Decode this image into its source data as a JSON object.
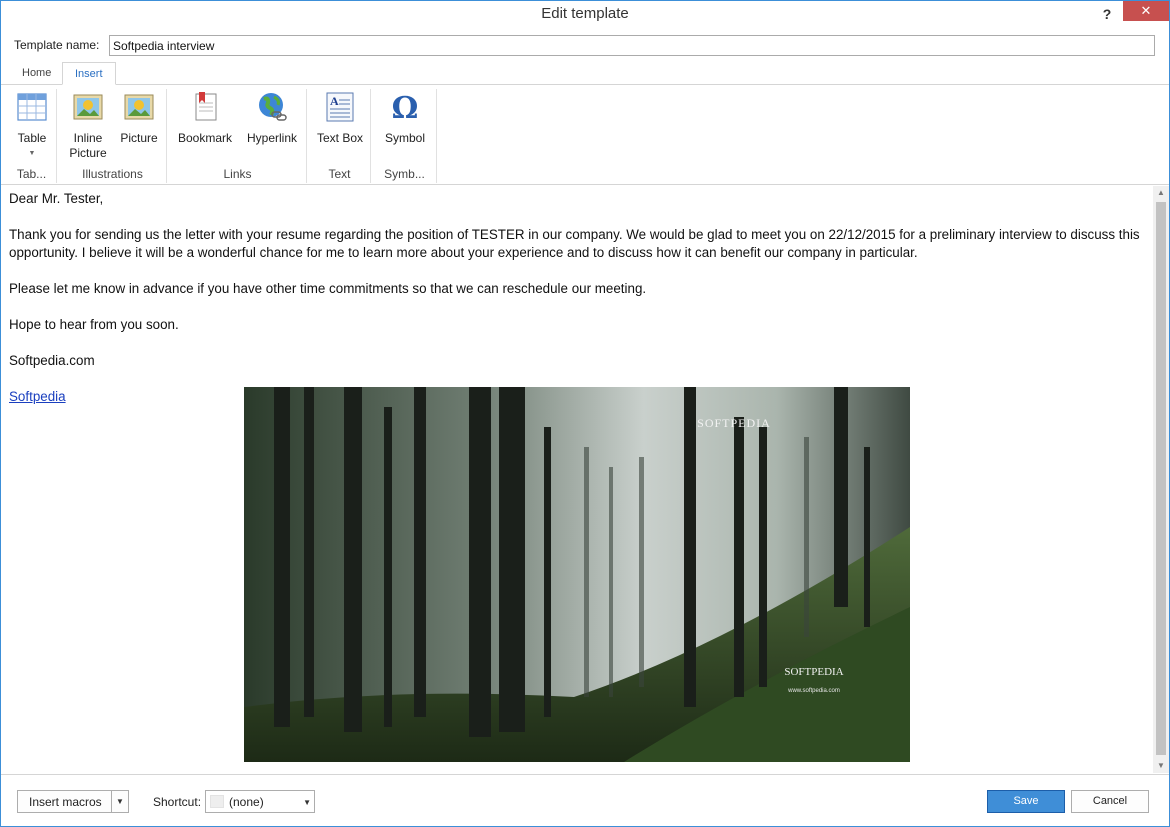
{
  "window": {
    "title": "Edit template",
    "help": "?",
    "close": "✕"
  },
  "template_name": {
    "label": "Template name:",
    "value": "Softpedia interview"
  },
  "tabs": [
    {
      "label": "Home"
    },
    {
      "label": "Insert"
    }
  ],
  "ribbon": {
    "groups": [
      {
        "label": "Tab...",
        "buttons": [
          {
            "label": "Table",
            "icon": "table-icon"
          }
        ]
      },
      {
        "label": "Illustrations",
        "buttons": [
          {
            "label": "Inline Picture",
            "line1": "Inline",
            "line2": "Picture",
            "icon": "inline-picture-icon"
          },
          {
            "label": "Picture",
            "icon": "picture-icon"
          }
        ]
      },
      {
        "label": "Links",
        "buttons": [
          {
            "label": "Bookmark",
            "icon": "bookmark-icon"
          },
          {
            "label": "Hyperlink",
            "icon": "hyperlink-icon"
          }
        ]
      },
      {
        "label": "Text",
        "buttons": [
          {
            "label": "Text Box",
            "icon": "text-box-icon"
          }
        ]
      },
      {
        "label": "Symb...",
        "buttons": [
          {
            "label": "Symbol",
            "icon": "omega-icon"
          }
        ]
      }
    ]
  },
  "document": {
    "salutation": "Dear  Mr. Tester,",
    "para1": "Thank you for sending us the letter with your resume regarding the position of TESTER in our company. We would be glad to meet you on 22/12/2015 for a preliminary interview to discuss this opportunity.  I believe it will be a wonderful chance for me to learn more about your experience and to discuss how it can benefit our company in particular.",
    "para2": "Please let me know in advance if you have other time commitments so that we can reschedule our meeting.",
    "para3": "Hope to hear from you soon.",
    "signature": "Softpedia.com",
    "link": "Softpedia",
    "image": {
      "watermark_top": "SOFTPEDIA",
      "watermark_bottom": "SOFTPEDIA",
      "watermark_url": "www.softpedia.com"
    }
  },
  "footer": {
    "insert_macros": "Insert macros",
    "shortcut_label": "Shortcut:",
    "shortcut_value": "(none)",
    "save": "Save",
    "cancel": "Cancel"
  },
  "colors": {
    "accent": "#3f8ed7",
    "close": "#c7504f",
    "link": "#1a3fbf",
    "active_tab": "#2a6fc2"
  }
}
